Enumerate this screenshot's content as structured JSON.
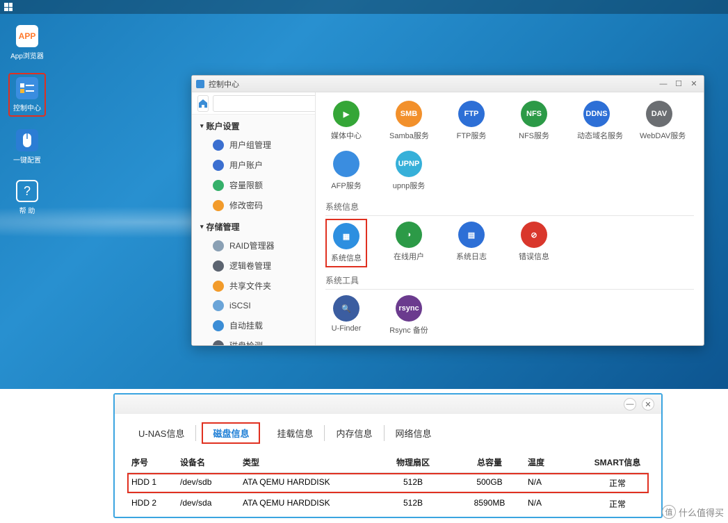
{
  "desktop_icons": [
    {
      "id": "app",
      "label": "App浏览器"
    },
    {
      "id": "ctrl",
      "label": "控制中心"
    },
    {
      "id": "cfg",
      "label": "一键配置"
    },
    {
      "id": "help",
      "label": "帮 助"
    }
  ],
  "window": {
    "title": "控制中心",
    "search_placeholder": ""
  },
  "sidebar": {
    "cat1": "账户设置",
    "items1": [
      "用户组管理",
      "用户账户",
      "容量限额",
      "修改密码"
    ],
    "cat2": "存储管理",
    "items2": [
      "RAID管理器",
      "逻辑卷管理",
      "共享文件夹",
      "iSCSI",
      "自动挂载",
      "磁盘检测"
    ]
  },
  "sections": {
    "services": [
      {
        "label": "媒体中心",
        "bg": "#35a637",
        "txt": "▶"
      },
      {
        "label": "Samba服务",
        "bg": "#f2902b",
        "txt": "SMB",
        "sq": true
      },
      {
        "label": "FTP服务",
        "bg": "#2d6fd6",
        "txt": "FTP",
        "sq": true
      },
      {
        "label": "NFS服务",
        "bg": "#2c9a47",
        "txt": "NFS"
      },
      {
        "label": "动态域名服务",
        "bg": "#2d6fd6",
        "txt": "DDNS"
      },
      {
        "label": "WebDAV服务",
        "bg": "#6b6e72",
        "txt": "DAV",
        "sq": true
      },
      {
        "label": "AFP服务",
        "bg": "#3a8de0",
        "txt": ""
      },
      {
        "label": "upnp服务",
        "bg": "#36b0d9",
        "txt": "UPNP"
      }
    ],
    "sysinfo_title": "系统信息",
    "sysinfo": [
      {
        "label": "系统信息",
        "bg": "#2d8fe0",
        "txt": "▦",
        "hl": true
      },
      {
        "label": "在线用户",
        "bg": "#2c9a47",
        "txt": "◑"
      },
      {
        "label": "系统日志",
        "bg": "#2d6fd6",
        "txt": "▤"
      },
      {
        "label": "错误信息",
        "bg": "#d9372c",
        "txt": "⊘"
      }
    ],
    "systools_title": "系统工具",
    "systools": [
      {
        "label": "U-Finder",
        "bg": "#3b5da0",
        "txt": "🔍",
        "sq": true
      },
      {
        "label": "Rsync 备份",
        "bg": "#6b3b8e",
        "txt": "rsync"
      }
    ]
  },
  "lower": {
    "tabs": [
      "U-NAS信息",
      "磁盘信息",
      "挂载信息",
      "内存信息",
      "网络信息"
    ],
    "active_tab": 1,
    "headers": [
      "序号",
      "设备名",
      "类型",
      "物理扇区",
      "总容量",
      "温度",
      "SMART信息"
    ],
    "rows": [
      [
        "HDD 1",
        "/dev/sdb",
        "ATA QEMU HARDDISK",
        "512B",
        "500GB",
        "N/A",
        "正常"
      ],
      [
        "HDD 2",
        "/dev/sda",
        "ATA QEMU HARDDISK",
        "512B",
        "8590MB",
        "N/A",
        "正常"
      ]
    ],
    "highlight_row": 0
  },
  "watermark": "什么值得买",
  "chart_data": {
    "type": "table",
    "title": "磁盘信息",
    "columns": [
      "序号",
      "设备名",
      "类型",
      "物理扇区",
      "总容量",
      "温度",
      "SMART信息"
    ],
    "rows": [
      [
        "HDD 1",
        "/dev/sdb",
        "ATA QEMU HARDDISK",
        "512B",
        "500GB",
        "N/A",
        "正常"
      ],
      [
        "HDD 2",
        "/dev/sda",
        "ATA QEMU HARDDISK",
        "512B",
        "8590MB",
        "N/A",
        "正常"
      ]
    ]
  }
}
